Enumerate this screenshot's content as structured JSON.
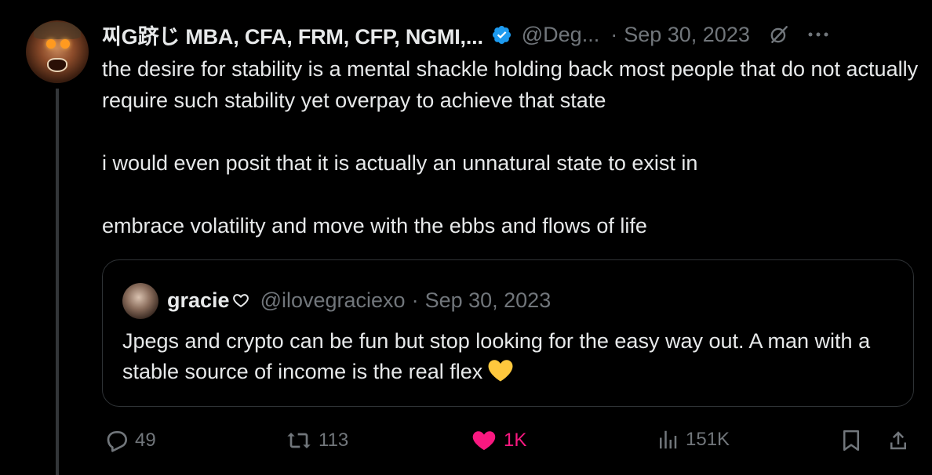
{
  "tweet": {
    "author_name": "찌G跻じ MBA, CFA, FRM, CFP, NGMI,...",
    "handle": "@Deg...",
    "separator": "·",
    "date": "Sep 30, 2023",
    "paragraphs": [
      "the desire for stability is a mental shackle holding back most people that do not actually require such stability yet overpay to achieve that state",
      "i would even posit that it is actually an unnatural state to exist in",
      "embrace volatility and move with the ebbs and flows of life"
    ]
  },
  "quote": {
    "author_name": "gracie",
    "handle": "@ilovegraciexo",
    "separator": "·",
    "date": "Sep 30, 2023",
    "text": "Jpegs and crypto can be fun but stop looking for the easy way out. A man with a stable source of income is the real flex"
  },
  "actions": {
    "replies": "49",
    "reposts": "113",
    "likes": "1K",
    "views": "151K"
  },
  "colors": {
    "background": "#000000",
    "text": "#e7e9ea",
    "muted": "#71767b",
    "verified": "#1d9bf0",
    "like": "#f91880",
    "border": "#2f3336",
    "heart_emoji": "#ffc83d"
  },
  "icons": [
    "verified-badge-icon",
    "grok-icon",
    "more-icon",
    "white-heart-icon",
    "yellow-heart-emoji",
    "reply-icon",
    "repost-icon",
    "like-icon",
    "views-icon",
    "bookmark-icon",
    "share-icon"
  ]
}
